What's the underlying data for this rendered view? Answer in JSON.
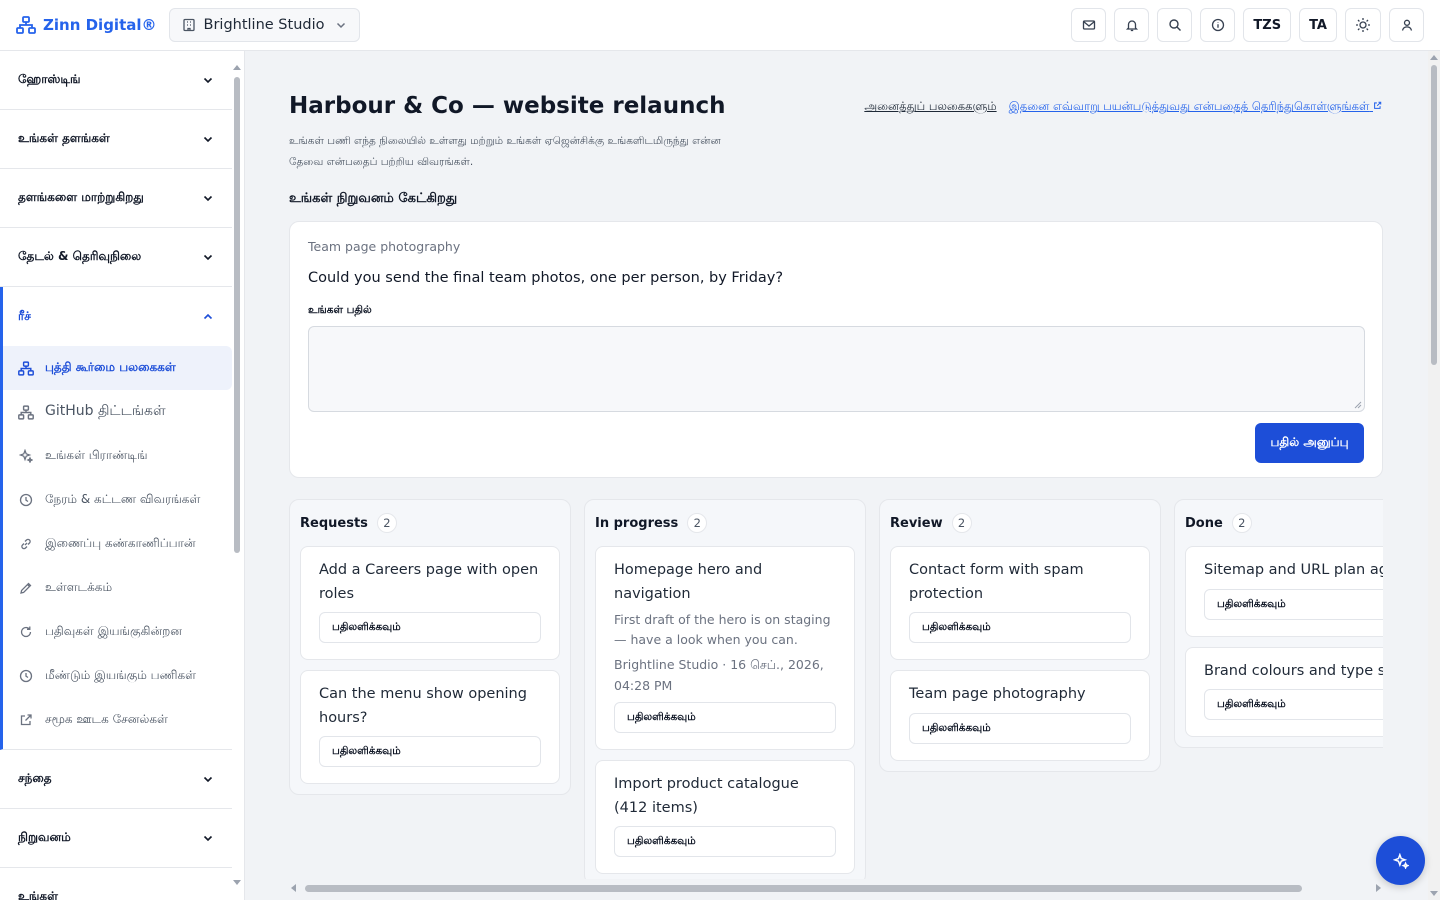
{
  "brand": {
    "name": "Zinn Digital®",
    "accent": "#2563eb"
  },
  "workspace": {
    "name": "Brightline Studio"
  },
  "topbar": {
    "tz_label": "TZS",
    "lang_label": "TA"
  },
  "sidebar": {
    "sections": [
      {
        "label": "ஹோஸ்டிங்"
      },
      {
        "label": "உங்கள் தளங்கள்"
      },
      {
        "label": "தளங்களை மாற்றுகிறது"
      },
      {
        "label": "தேடல் & தெரிவுநிலை"
      }
    ],
    "open_section": {
      "label": "ரீச்"
    },
    "items": [
      {
        "label": "புத்தி கூர்மை பலகைகள்",
        "icon": "network-icon"
      },
      {
        "label": "GitHub திட்டங்கள்",
        "icon": "network-icon"
      },
      {
        "label": "உங்கள் பிராண்டிங்",
        "icon": "sparkle-icon"
      },
      {
        "label": "நேரம் & கட்டண விவரங்கள்",
        "icon": "clock-icon"
      },
      {
        "label": "இணைப்பு கண்காணிப்பான்",
        "icon": "link-icon"
      },
      {
        "label": "உள்ளடக்கம்",
        "icon": "pencil-icon"
      },
      {
        "label": "பதிவுகள் இயங்குகின்றன",
        "icon": "refresh-icon"
      },
      {
        "label": "மீண்டும் இயங்கும் பணிகள்",
        "icon": "clock-icon"
      },
      {
        "label": "சமூக ஊடக சேனல்கள்",
        "icon": "external-link-icon"
      }
    ],
    "lower_sections": [
      {
        "label": "சந்தை"
      },
      {
        "label": "நிறுவனம்"
      },
      {
        "label": "உங்கள்"
      }
    ]
  },
  "page": {
    "title": "Harbour & Co — website relaunch",
    "all_boards_link": "அனைத்துப் பலகைகளும்",
    "help_link": "இதனை எவ்வாறு பயன்படுத்துவது என்பதைத் தெரிந்துகொள்ளுங்கள்",
    "subtitle": "உங்கள் பணி எந்த நிலையில் உள்ளது மற்றும் உங்கள் ஏஜென்சிக்கு உங்களிடமிருந்து என்ன தேவை என்பதைப் பற்றிய விவரங்கள்.",
    "asks_heading": "உங்கள் நிறுவனம் கேட்கிறது"
  },
  "ask": {
    "tag": "Team page photography",
    "question": "Could you send the final team photos, one per person, by Friday?",
    "reply_label": "உங்கள் பதில்",
    "send_label": "பதில் அனுப்பு"
  },
  "board": {
    "reply_label": "பதிலளிக்கவும்",
    "columns": [
      {
        "name": "Requests",
        "count": "2",
        "cards": [
          {
            "title": "Add a Careers page with open roles"
          },
          {
            "title": "Can the menu show opening hours?"
          }
        ]
      },
      {
        "name": "In progress",
        "count": "2",
        "cards": [
          {
            "title": "Homepage hero and navigation",
            "note": "First draft of the hero is on staging — have a look when you can.",
            "meta": "Brightline Studio · 16 செப்., 2026, 04:28 PM"
          },
          {
            "title": "Import product catalogue (412 items)"
          }
        ]
      },
      {
        "name": "Review",
        "count": "2",
        "cards": [
          {
            "title": "Contact form with spam protection"
          },
          {
            "title": "Team page photography"
          }
        ]
      },
      {
        "name": "Done",
        "count": "2",
        "cards": [
          {
            "title": "Sitemap and URL plan agreed"
          },
          {
            "title": "Brand colours and type set"
          }
        ]
      }
    ]
  }
}
